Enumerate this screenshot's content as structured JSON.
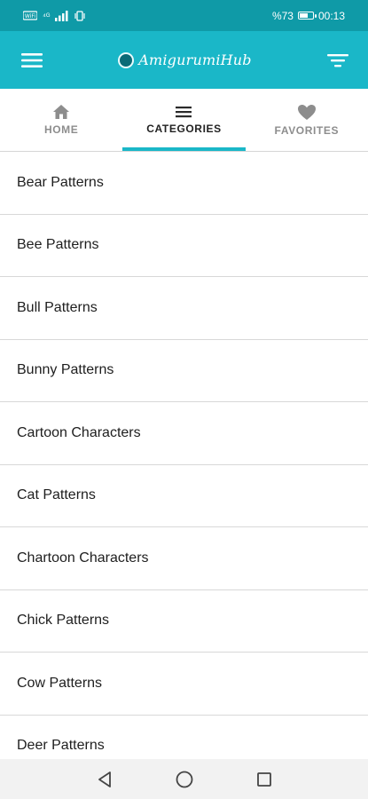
{
  "status_bar": {
    "left_text": "⁴ᴳ",
    "battery_percent": "%73",
    "time": "00:13",
    "battery_level": 0.73
  },
  "app_bar": {
    "logo_text": "AmigurumiHub",
    "menu_icon": "hamburger-menu-icon",
    "filter_icon": "filter-icon",
    "background_color": "#1ab7c8"
  },
  "tabs": [
    {
      "label": "HOME",
      "icon": "home-icon",
      "active": false
    },
    {
      "label": "CATEGORIES",
      "icon": "list-icon",
      "active": true
    },
    {
      "label": "FAVORITES",
      "icon": "heart-icon",
      "active": false
    }
  ],
  "categories": [
    "Bear Patterns",
    "Bee Patterns",
    "Bull Patterns",
    "Bunny Patterns",
    "Cartoon Characters",
    "Cat Patterns",
    "Chartoon Characters",
    "Chick Patterns",
    "Cow Patterns",
    "Deer Patterns"
  ],
  "nav_bar": {
    "back_icon": "back-triangle-icon",
    "home_icon": "home-circle-icon",
    "recents_icon": "recents-square-icon"
  }
}
